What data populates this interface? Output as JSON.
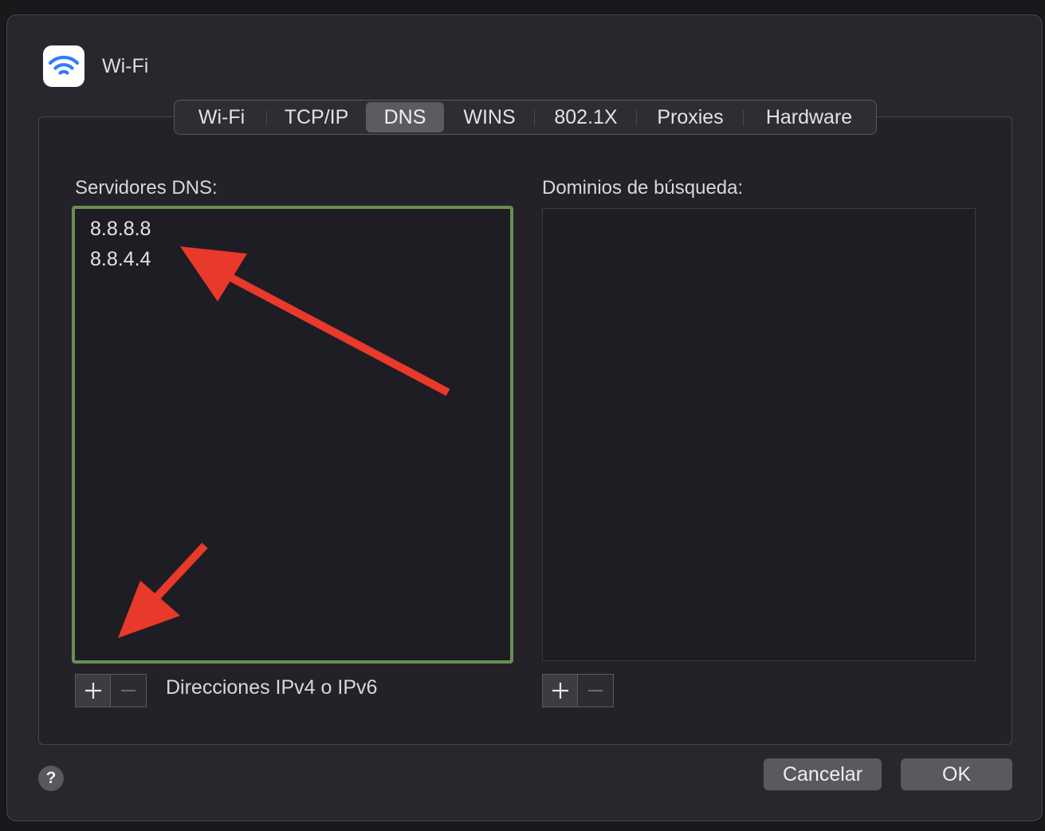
{
  "window": {
    "title": "Wi-Fi",
    "app_icon": "wifi-icon"
  },
  "tabs": [
    {
      "label": "Wi-Fi",
      "active": false
    },
    {
      "label": "TCP/IP",
      "active": false
    },
    {
      "label": "DNS",
      "active": true
    },
    {
      "label": "WINS",
      "active": false
    },
    {
      "label": "802.1X",
      "active": false
    },
    {
      "label": "Proxies",
      "active": false
    },
    {
      "label": "Hardware",
      "active": false
    }
  ],
  "dns": {
    "label": "Servidores DNS:",
    "servers": [
      "8.8.8.8",
      "8.8.4.4"
    ],
    "hint": "Direcciones IPv4 o IPv6"
  },
  "domains": {
    "label": "Dominios de búsqueda:",
    "entries": []
  },
  "buttons": {
    "help": "?",
    "cancel": "Cancelar",
    "ok": "OK"
  },
  "icons": {
    "add": "plus-icon",
    "remove": "minus-icon"
  },
  "colors": {
    "highlight_border": "#688f52",
    "annotation_arrow": "#e8392a",
    "active_tab": "#5d5b61"
  }
}
